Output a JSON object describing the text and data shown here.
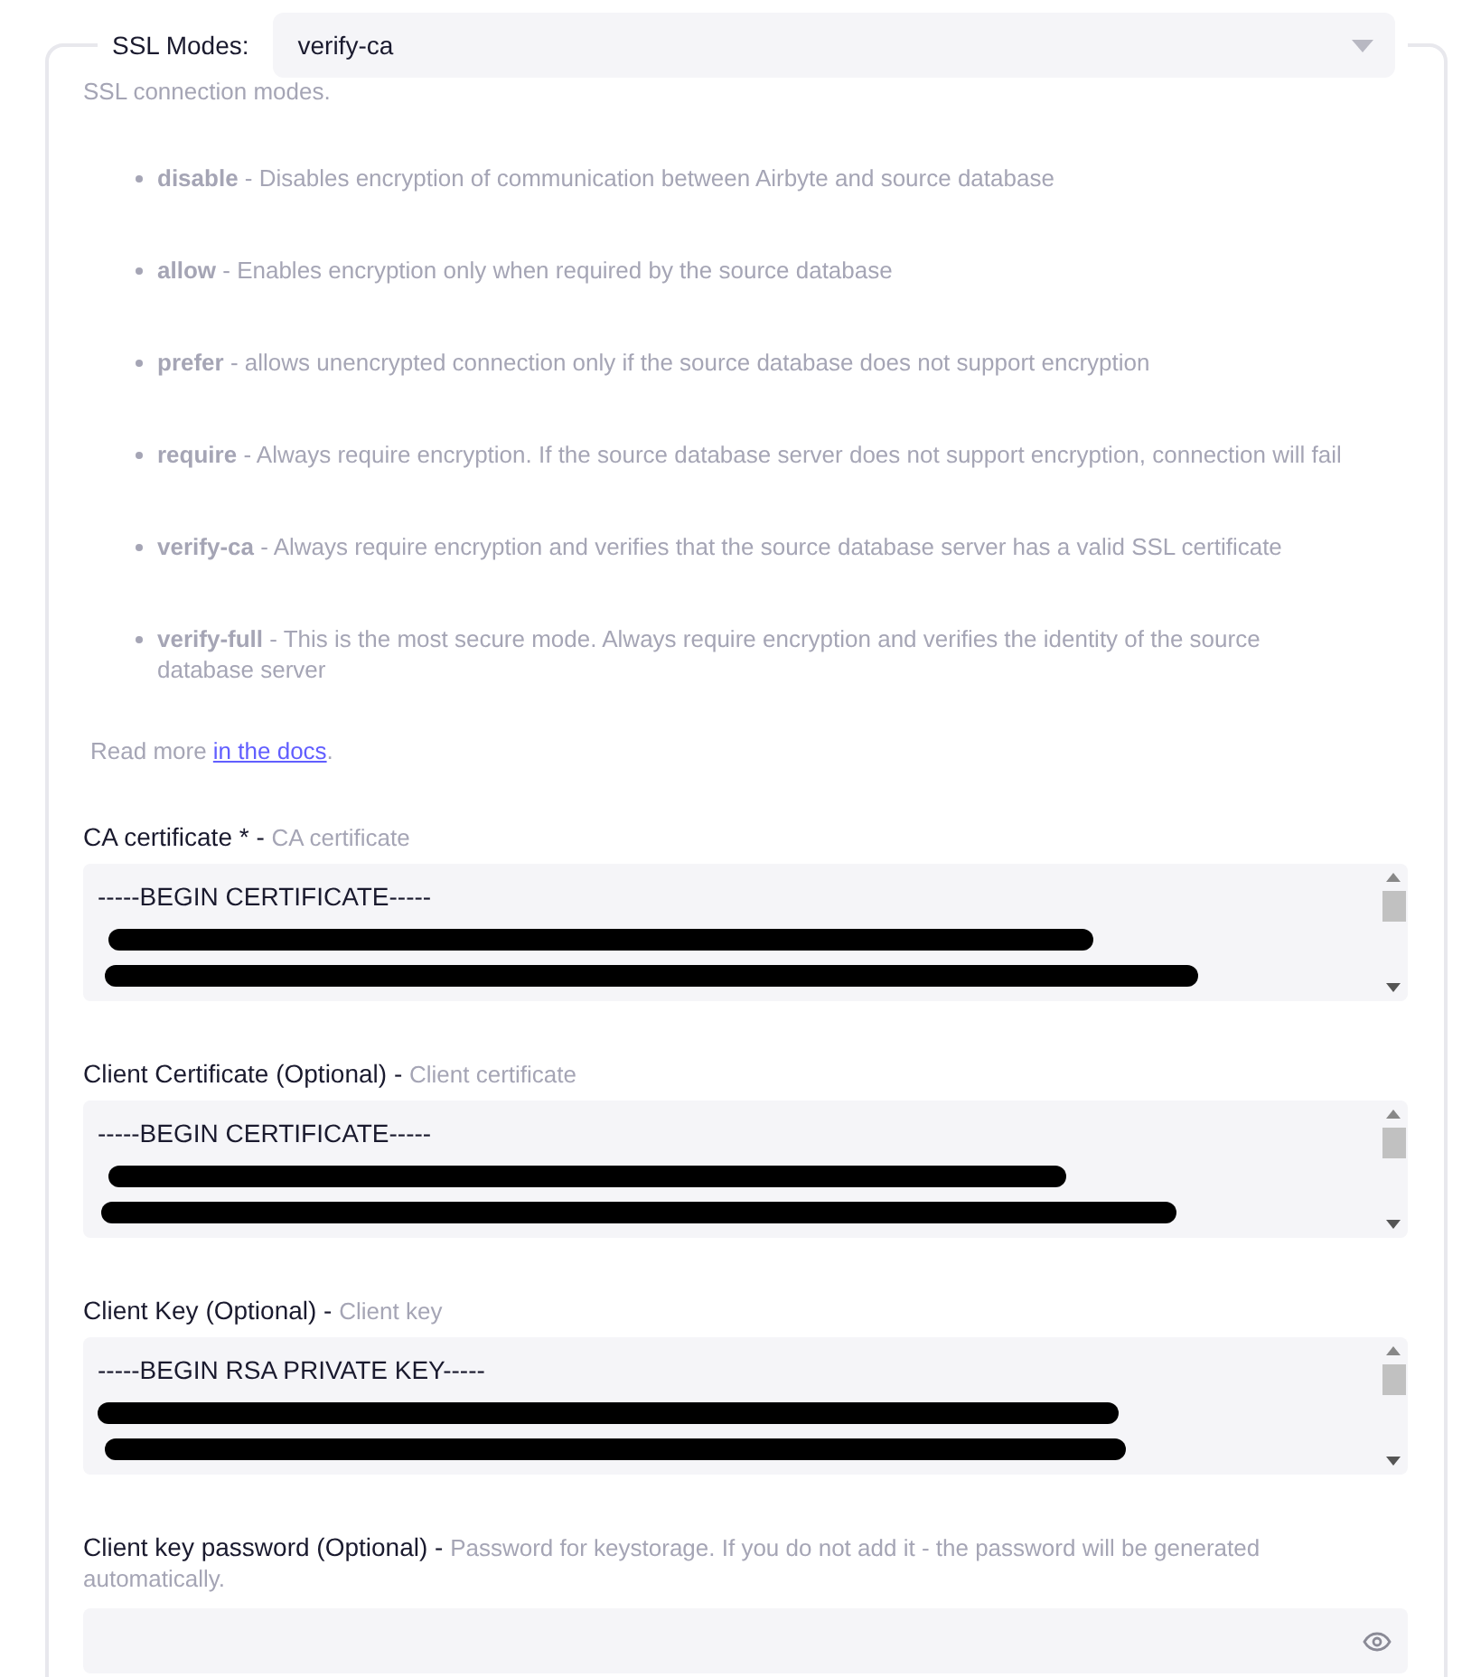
{
  "ssl_mode": {
    "label": "SSL Modes:",
    "value": "verify-ca",
    "description": "SSL connection modes."
  },
  "modes": [
    {
      "name": "disable",
      "description": "- Disables encryption of communication between Airbyte and source database"
    },
    {
      "name": "allow",
      "description": "- Enables encryption only when required by the source database"
    },
    {
      "name": "prefer",
      "description": "- allows unencrypted connection only if the source database does not support encryption"
    },
    {
      "name": "require",
      "description": "- Always require encryption. If the source database server does not support encryption, connection will fail"
    },
    {
      "name": "verify-ca",
      "description": "- Always require encryption and verifies that the source database server has a valid SSL certificate"
    },
    {
      "name": "verify-full",
      "description": "- This is the most secure mode. Always require encryption and verifies the identity of the source database server"
    }
  ],
  "read_more": {
    "text": "Read more",
    "link": "in the docs",
    "end": "."
  },
  "fields": [
    {
      "kind": "textarea",
      "label": "CA certificate * -",
      "hint": "CA certificate",
      "value": "-----BEGIN CERTIFICATE-----"
    },
    {
      "kind": "textarea",
      "label": "Client Certificate (Optional) -",
      "hint": "Client certificate",
      "value": "-----BEGIN CERTIFICATE-----"
    },
    {
      "kind": "textarea",
      "label": "Client Key (Optional) -",
      "hint": "Client key",
      "value": "-----BEGIN RSA PRIVATE KEY-----"
    },
    {
      "kind": "password",
      "label": "Client key password (Optional) -",
      "hint": "Password for keystorage. If you do not add it - the password will be generated automatically."
    }
  ]
}
